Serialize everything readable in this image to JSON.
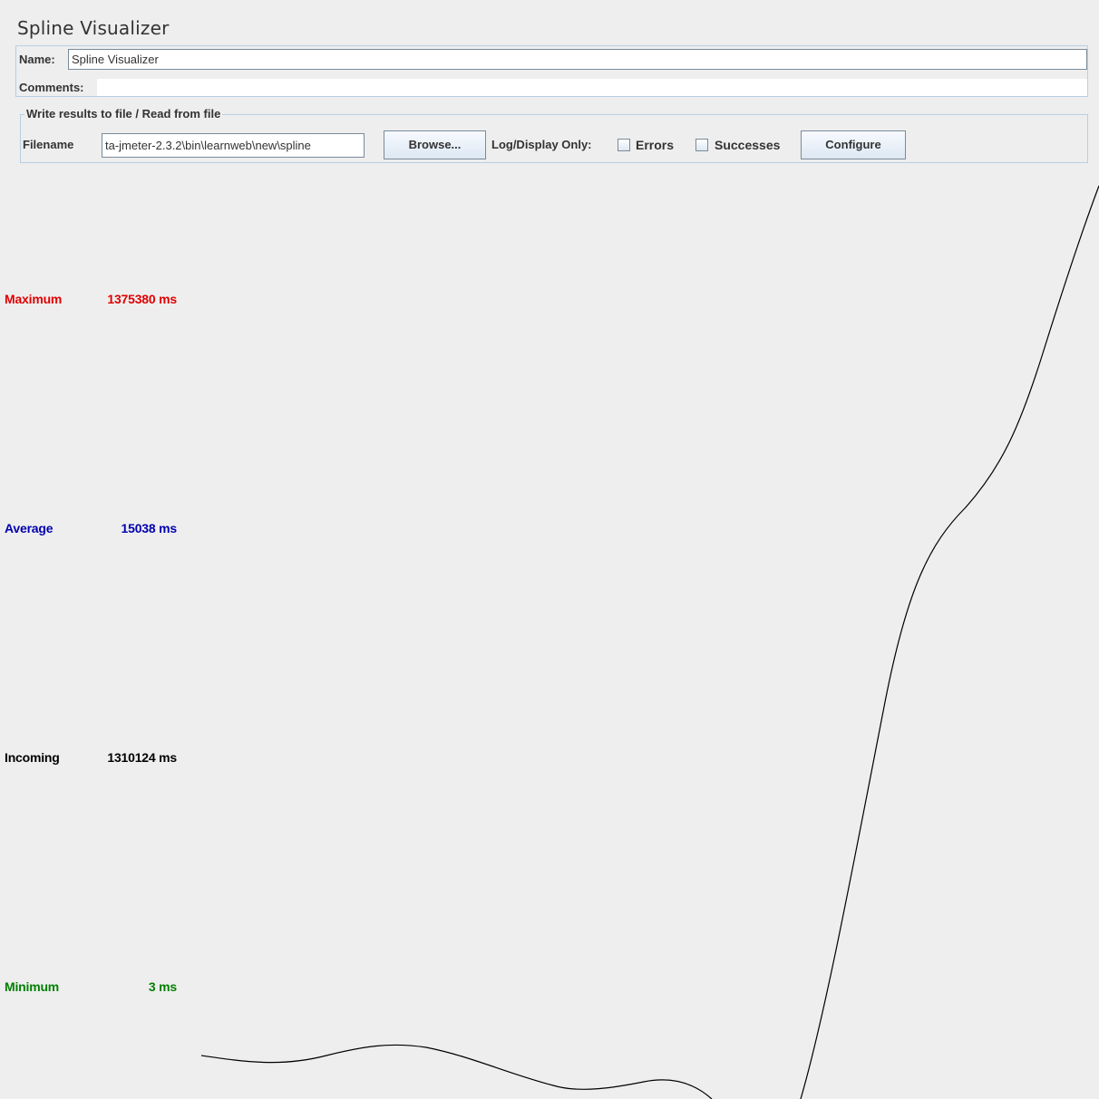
{
  "title": "Spline Visualizer",
  "name_field": {
    "label": "Name:",
    "value": "Spline Visualizer"
  },
  "comments_field": {
    "label": "Comments:",
    "value": ""
  },
  "file_section": {
    "legend": "Write results to file / Read from file",
    "filename_label": "Filename",
    "filename_value": "ta-jmeter-2.3.2\\bin\\learnweb\\new\\spline",
    "browse_label": "Browse...",
    "log_display_label": "Log/Display Only:",
    "errors_label": "Errors",
    "errors_checked": false,
    "successes_label": "Successes",
    "successes_checked": false,
    "configure_label": "Configure"
  },
  "stats": {
    "maximum": {
      "label": "Maximum",
      "value": "1375380 ms",
      "color": "#e00000"
    },
    "average": {
      "label": "Average",
      "value": "15038 ms",
      "color": "#0000b0"
    },
    "incoming": {
      "label": "Incoming",
      "value": "1310124 ms",
      "color": "#000000"
    },
    "minimum": {
      "label": "Minimum",
      "value": "3 ms",
      "color": "#008000"
    }
  }
}
